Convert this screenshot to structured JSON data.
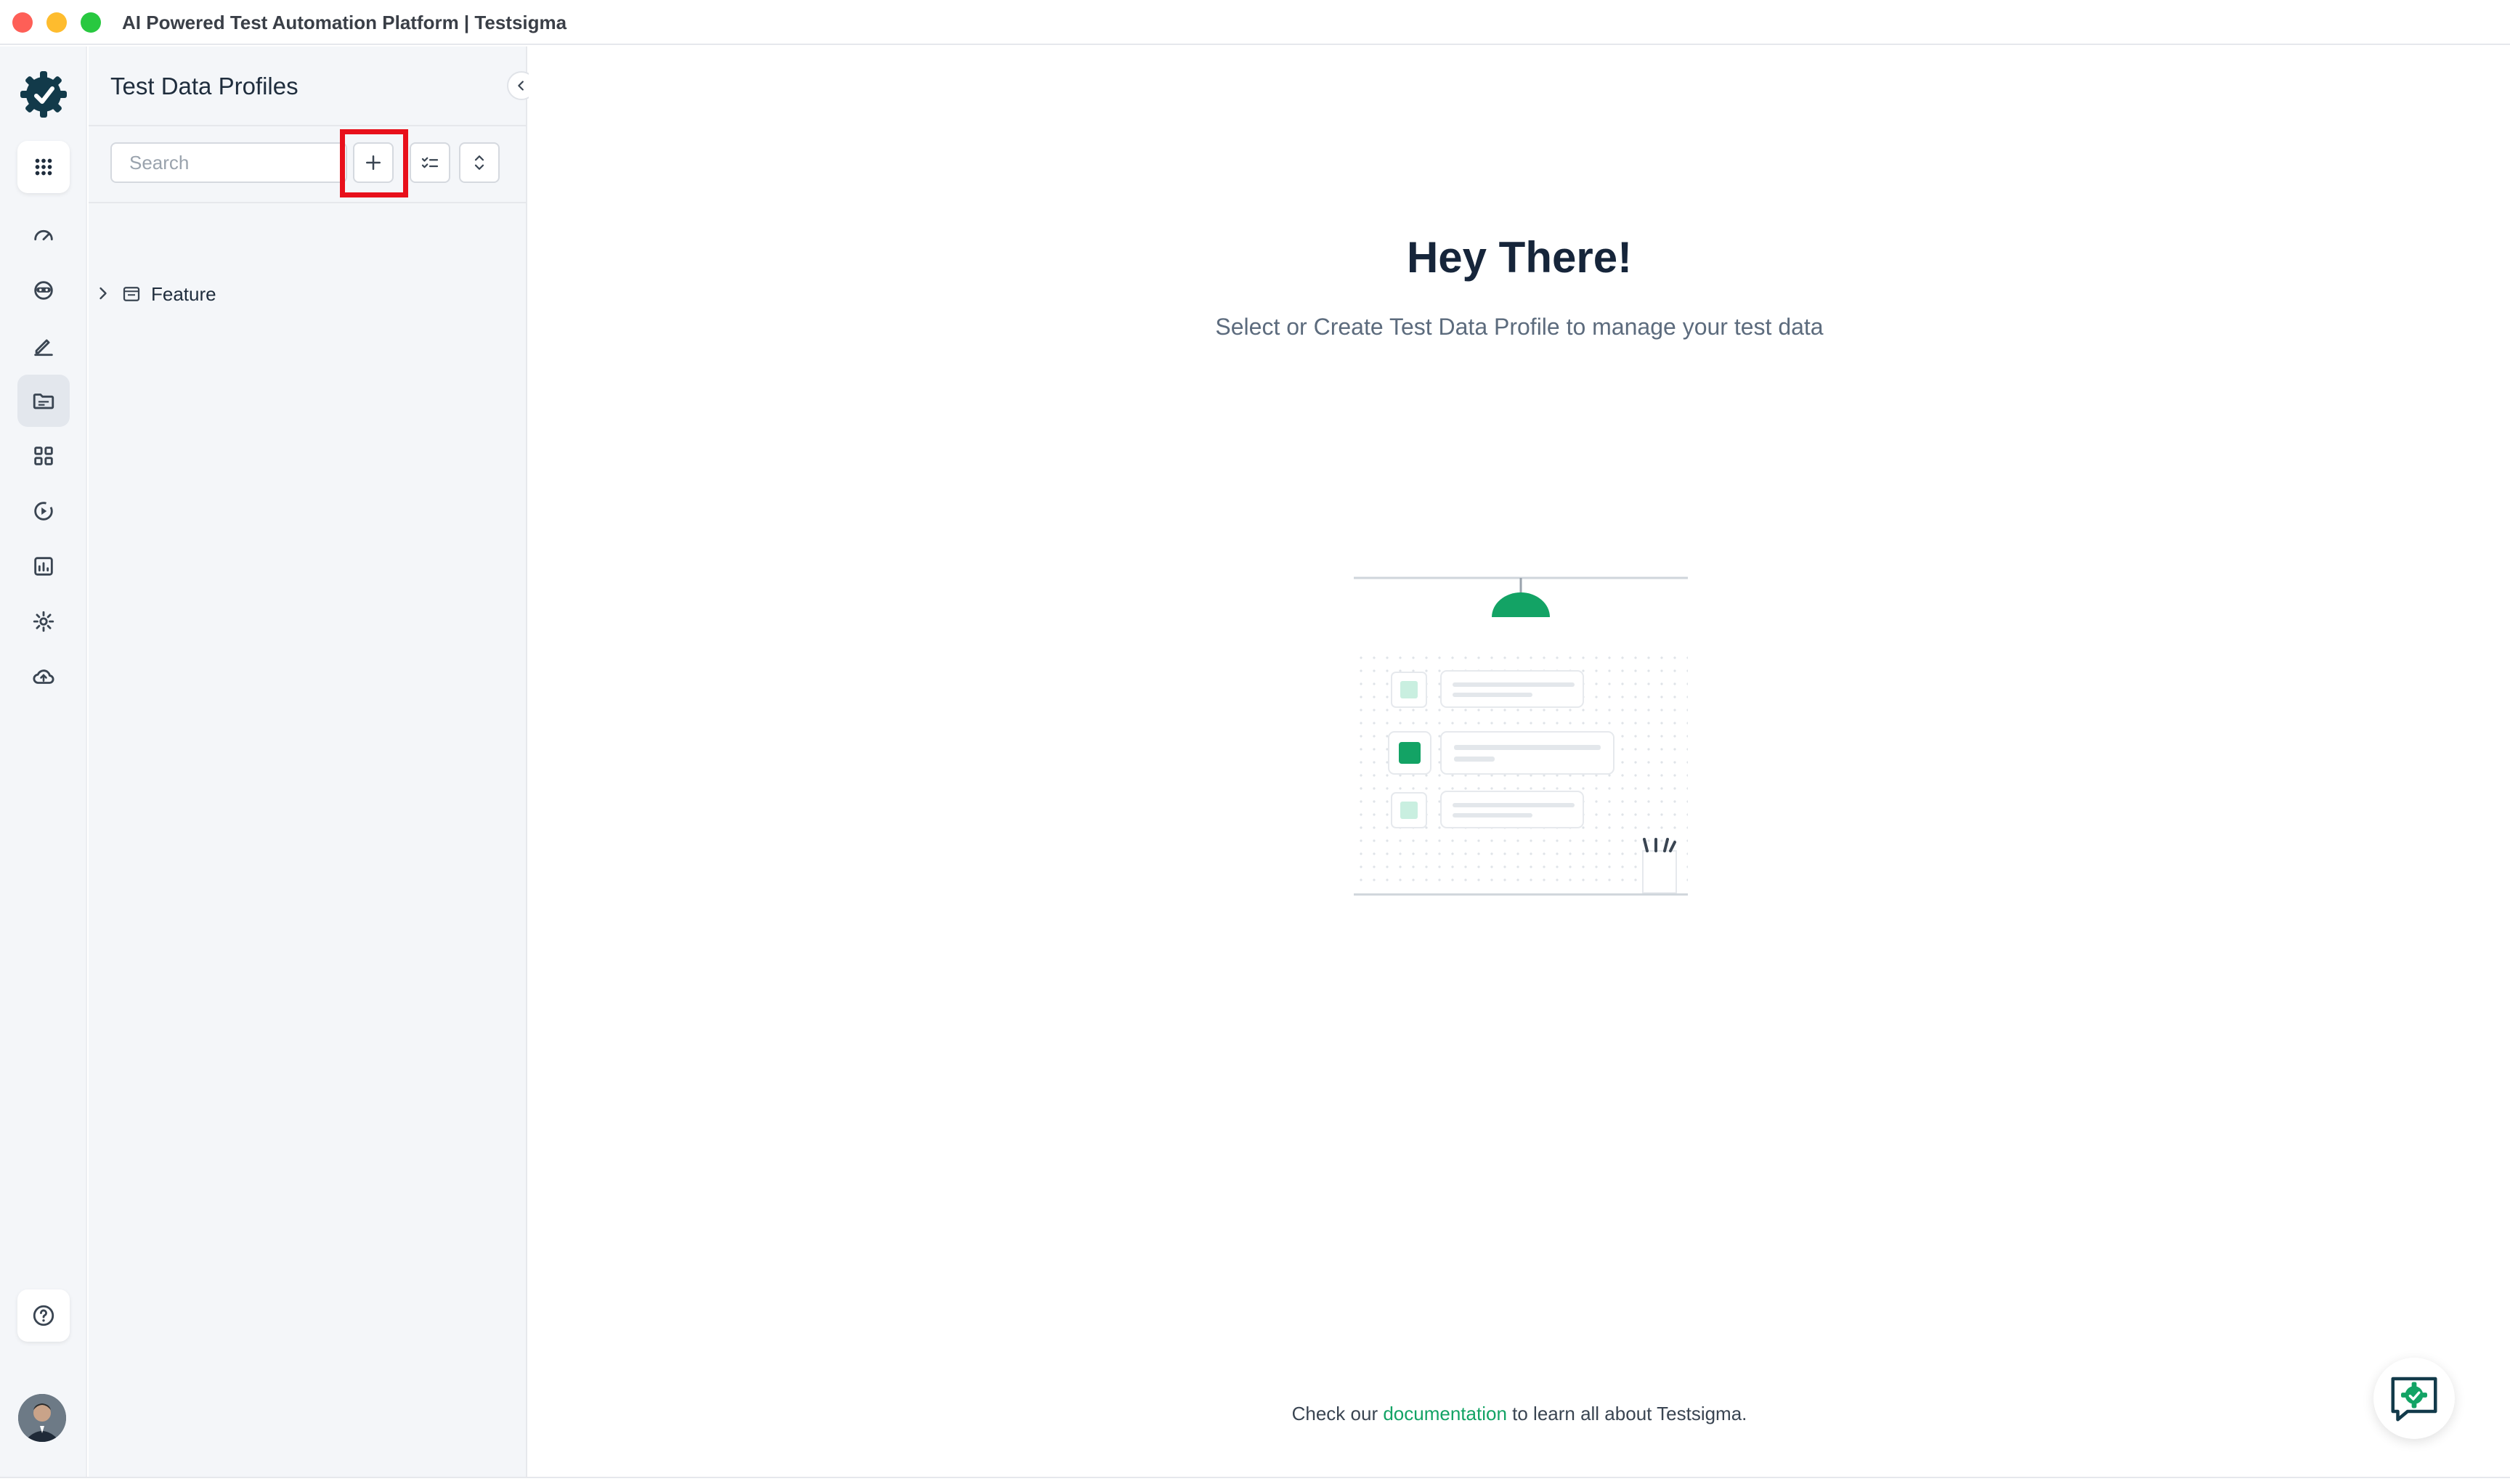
{
  "window": {
    "title": "AI Powered Test Automation Platform | Testsigma"
  },
  "rail": {
    "items": [
      {
        "icon": "apps-grid-icon"
      },
      {
        "icon": "dashboard-gauge-icon"
      },
      {
        "icon": "ai-agent-icon"
      },
      {
        "icon": "pencil-icon"
      },
      {
        "icon": "folder-icon",
        "active": true
      },
      {
        "icon": "modules-grid-icon"
      },
      {
        "icon": "run-play-icon"
      },
      {
        "icon": "reports-chart-icon"
      },
      {
        "icon": "settings-gear-icon"
      },
      {
        "icon": "cloud-upload-icon"
      }
    ],
    "help_icon": "help-circle-icon"
  },
  "panel": {
    "title": "Test Data Profiles",
    "search_placeholder": "Search",
    "tree": [
      {
        "label": "Feature",
        "icon": "folder-icon"
      }
    ]
  },
  "main": {
    "heading": "Hey There!",
    "subheading": "Select or Create Test Data Profile to manage your test data",
    "footer_prefix": "Check our ",
    "footer_link": "documentation",
    "footer_suffix": " to learn all about Testsigma."
  },
  "colors": {
    "accent": "#13a365",
    "highlight": "#e8101b",
    "brand_dark": "#123a4a"
  }
}
